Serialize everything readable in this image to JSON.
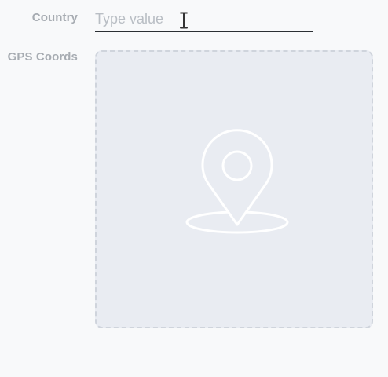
{
  "form": {
    "country": {
      "label": "Country",
      "value": "",
      "placeholder": "Type value"
    },
    "gps_coords": {
      "label": "GPS Coords",
      "icon": "map-pin-icon"
    }
  },
  "colors": {
    "label": "#a7acb2",
    "input_underline": "#2b2f33",
    "placeholder": "#b9bec4",
    "map_background": "#e9ecf2",
    "map_border": "#cfd4dc",
    "pin_stroke": "#ffffff"
  },
  "cursor": {
    "type": "text-cursor-icon"
  }
}
